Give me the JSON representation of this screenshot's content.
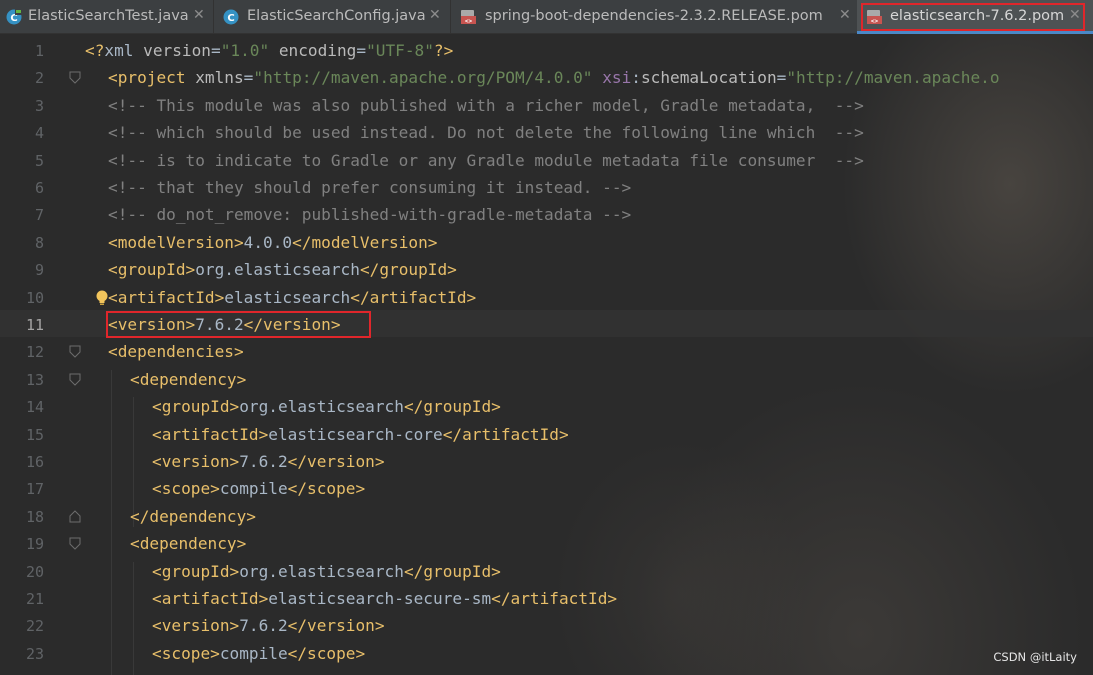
{
  "tabs": [
    {
      "label": "ElasticSearchTest.java",
      "icon": "java-class-icon",
      "active": false
    },
    {
      "label": "ElasticSearchConfig.java",
      "icon": "java-class-icon",
      "active": false
    },
    {
      "label": "spring-boot-dependencies-2.3.2.RELEASE.pom",
      "icon": "maven-pom-icon",
      "active": false
    },
    {
      "label": "elasticsearch-7.6.2.pom",
      "icon": "maven-pom-icon",
      "active": true
    }
  ],
  "close_glyph": "✕",
  "editor": {
    "current_line": 11,
    "lines": [
      {
        "n": "1",
        "tokens": [
          [
            "b",
            "<?"
          ],
          [
            "t",
            "xml "
          ],
          [
            "a",
            "version"
          ],
          [
            "t",
            "="
          ],
          [
            "v",
            "\"1.0\""
          ],
          [
            "t",
            " "
          ],
          [
            "a",
            "encoding"
          ],
          [
            "t",
            "="
          ],
          [
            "v",
            "\"UTF-8\""
          ],
          [
            "b",
            "?>"
          ]
        ]
      },
      {
        "n": "2",
        "tokens": [
          [
            "b",
            "<project "
          ],
          [
            "a",
            "xmlns"
          ],
          [
            "t",
            "="
          ],
          [
            "v",
            "\"http://maven.apache.org/POM/4.0.0\""
          ],
          [
            "t",
            " "
          ],
          [
            "n",
            "xsi"
          ],
          [
            "t",
            ":"
          ],
          [
            "a",
            "schemaLocation"
          ],
          [
            "t",
            "="
          ],
          [
            "v",
            "\"http://maven.apache.o"
          ]
        ]
      },
      {
        "n": "3",
        "tokens": [
          [
            "c",
            "<!-- This module was also published with a richer model, Gradle metadata,  -->"
          ]
        ]
      },
      {
        "n": "4",
        "tokens": [
          [
            "c",
            "<!-- which should be used instead. Do not delete the following line which  -->"
          ]
        ]
      },
      {
        "n": "5",
        "tokens": [
          [
            "c",
            "<!-- is to indicate to Gradle or any Gradle module metadata file consumer  -->"
          ]
        ]
      },
      {
        "n": "6",
        "tokens": [
          [
            "c",
            "<!-- that they should prefer consuming it instead. -->"
          ]
        ]
      },
      {
        "n": "7",
        "tokens": [
          [
            "c",
            "<!-- do_not_remove: published-with-gradle-metadata -->"
          ]
        ]
      },
      {
        "n": "8",
        "tokens": [
          [
            "b",
            "<modelVersion>"
          ],
          [
            "t",
            "4.0.0"
          ],
          [
            "b",
            "</modelVersion>"
          ]
        ]
      },
      {
        "n": "9",
        "tokens": [
          [
            "b",
            "<groupId>"
          ],
          [
            "t",
            "org.elasticsearch"
          ],
          [
            "b",
            "</groupId>"
          ]
        ]
      },
      {
        "n": "10",
        "tokens": [
          [
            "b",
            "<artifactId>"
          ],
          [
            "t",
            "elasticsearch"
          ],
          [
            "b",
            "</artifactId>"
          ]
        ]
      },
      {
        "n": "11",
        "tokens": [
          [
            "b",
            "<version>"
          ],
          [
            "t",
            "7.6.2"
          ],
          [
            "b",
            "</version>"
          ]
        ]
      },
      {
        "n": "12",
        "tokens": [
          [
            "b",
            "<dependencies>"
          ]
        ]
      },
      {
        "n": "13",
        "tokens": [
          [
            "b",
            "<dependency>"
          ]
        ]
      },
      {
        "n": "14",
        "tokens": [
          [
            "b",
            "<groupId>"
          ],
          [
            "t",
            "org.elasticsearch"
          ],
          [
            "b",
            "</groupId>"
          ]
        ]
      },
      {
        "n": "15",
        "tokens": [
          [
            "b",
            "<artifactId>"
          ],
          [
            "t",
            "elasticsearch-core"
          ],
          [
            "b",
            "</artifactId>"
          ]
        ]
      },
      {
        "n": "16",
        "tokens": [
          [
            "b",
            "<version>"
          ],
          [
            "t",
            "7.6.2"
          ],
          [
            "b",
            "</version>"
          ]
        ]
      },
      {
        "n": "17",
        "tokens": [
          [
            "b",
            "<scope>"
          ],
          [
            "t",
            "compile"
          ],
          [
            "b",
            "</scope>"
          ]
        ]
      },
      {
        "n": "18",
        "tokens": [
          [
            "b",
            "</dependency>"
          ]
        ]
      },
      {
        "n": "19",
        "tokens": [
          [
            "b",
            "<dependency>"
          ]
        ]
      },
      {
        "n": "20",
        "tokens": [
          [
            "b",
            "<groupId>"
          ],
          [
            "t",
            "org.elasticsearch"
          ],
          [
            "b",
            "</groupId>"
          ]
        ]
      },
      {
        "n": "21",
        "tokens": [
          [
            "b",
            "<artifactId>"
          ],
          [
            "t",
            "elasticsearch-secure-sm"
          ],
          [
            "b",
            "</artifactId>"
          ]
        ]
      },
      {
        "n": "22",
        "tokens": [
          [
            "b",
            "<version>"
          ],
          [
            "t",
            "7.6.2"
          ],
          [
            "b",
            "</version>"
          ]
        ]
      },
      {
        "n": "23",
        "tokens": [
          [
            "b",
            "<scope>"
          ],
          [
            "t",
            "compile"
          ],
          [
            "b",
            "</scope>"
          ]
        ]
      }
    ]
  },
  "watermark": "CSDN @itLaity",
  "colors": {
    "tag": "#e8bf6a",
    "attribute": "#bababa",
    "string": "#6a8759",
    "comment": "#808080",
    "text": "#a9b7c6",
    "namespace": "#9876aa",
    "highlight_box": "#e0262b",
    "active_tab_underline": "#4a88c7"
  }
}
